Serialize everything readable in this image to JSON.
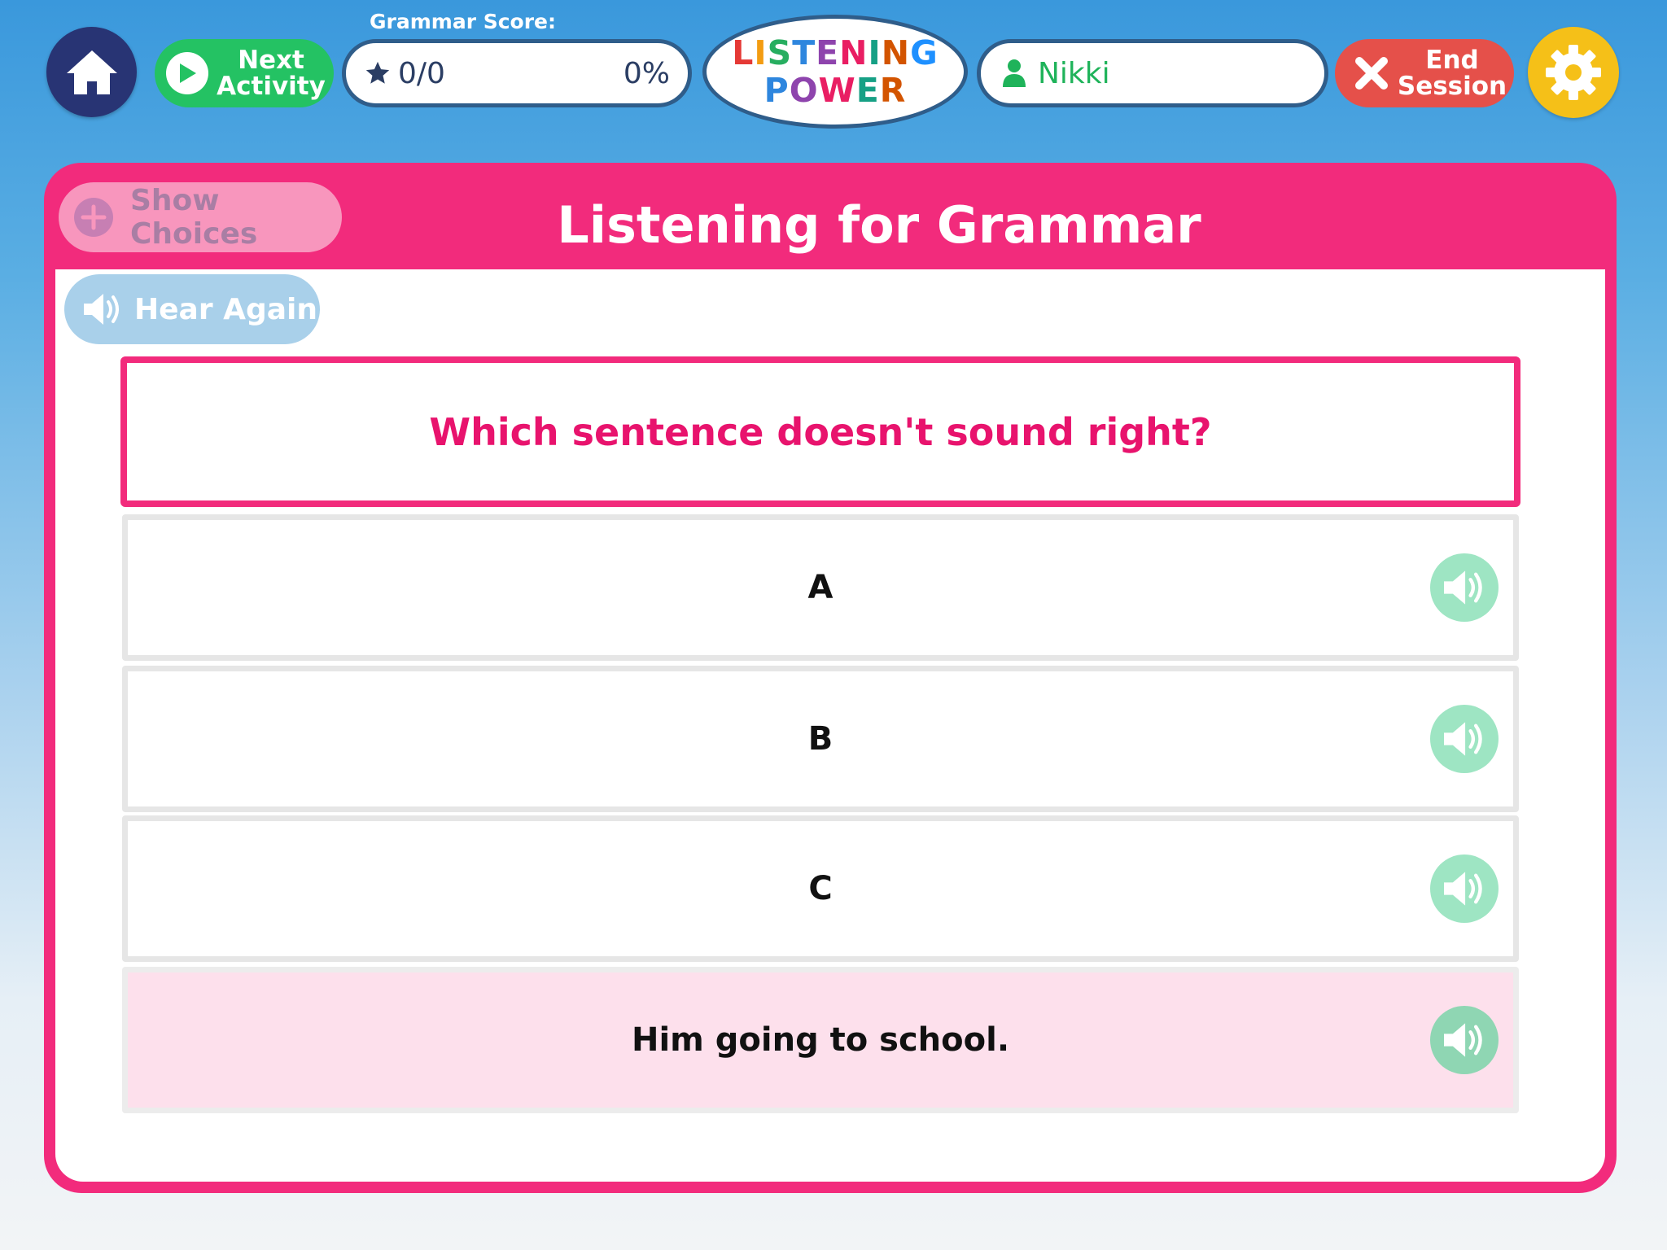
{
  "header": {
    "next_activity_label": "Next\nActivity",
    "score_title": "Grammar Score:",
    "score_count": "0/0",
    "score_percent": "0%",
    "logo_line1": [
      "L",
      "I",
      "S",
      "T",
      "E",
      "N",
      "I",
      "N",
      "G"
    ],
    "logo_line2": [
      "P",
      "O",
      "W",
      "E",
      "R"
    ],
    "logo_colors": [
      "#e53935",
      "#f39c12",
      "#27ae60",
      "#2e86de",
      "#8e44ad",
      "#e91e63",
      "#16a085",
      "#d35400",
      "#1e90ff"
    ],
    "user_name": "Nikki",
    "end_session_label": "End\nSession"
  },
  "panel": {
    "show_choices_label": "Show Choices",
    "title": "Listening for Grammar",
    "hear_again_label": "Hear Again",
    "question": "Which sentence doesn't sound right?",
    "choices": [
      {
        "text": "A",
        "selected": false
      },
      {
        "text": "B",
        "selected": false
      },
      {
        "text": "C",
        "selected": false
      },
      {
        "text": "Him going to school.",
        "selected": true
      }
    ]
  },
  "colors": {
    "accent_pink": "#f22b7c",
    "home_navy": "#283474",
    "next_green": "#24c263",
    "end_red": "#e5504a",
    "settings_yellow": "#f5c018",
    "audio_mint": "#9ee5c3"
  },
  "icons": {
    "home": "home-icon",
    "next": "play-icon",
    "score": "star-icon",
    "user": "person-icon",
    "end": "close-icon",
    "settings": "gear-icon",
    "show_choices": "plus-circle-icon",
    "hear_again": "speaker-icon",
    "choice_audio": "speaker-icon"
  }
}
